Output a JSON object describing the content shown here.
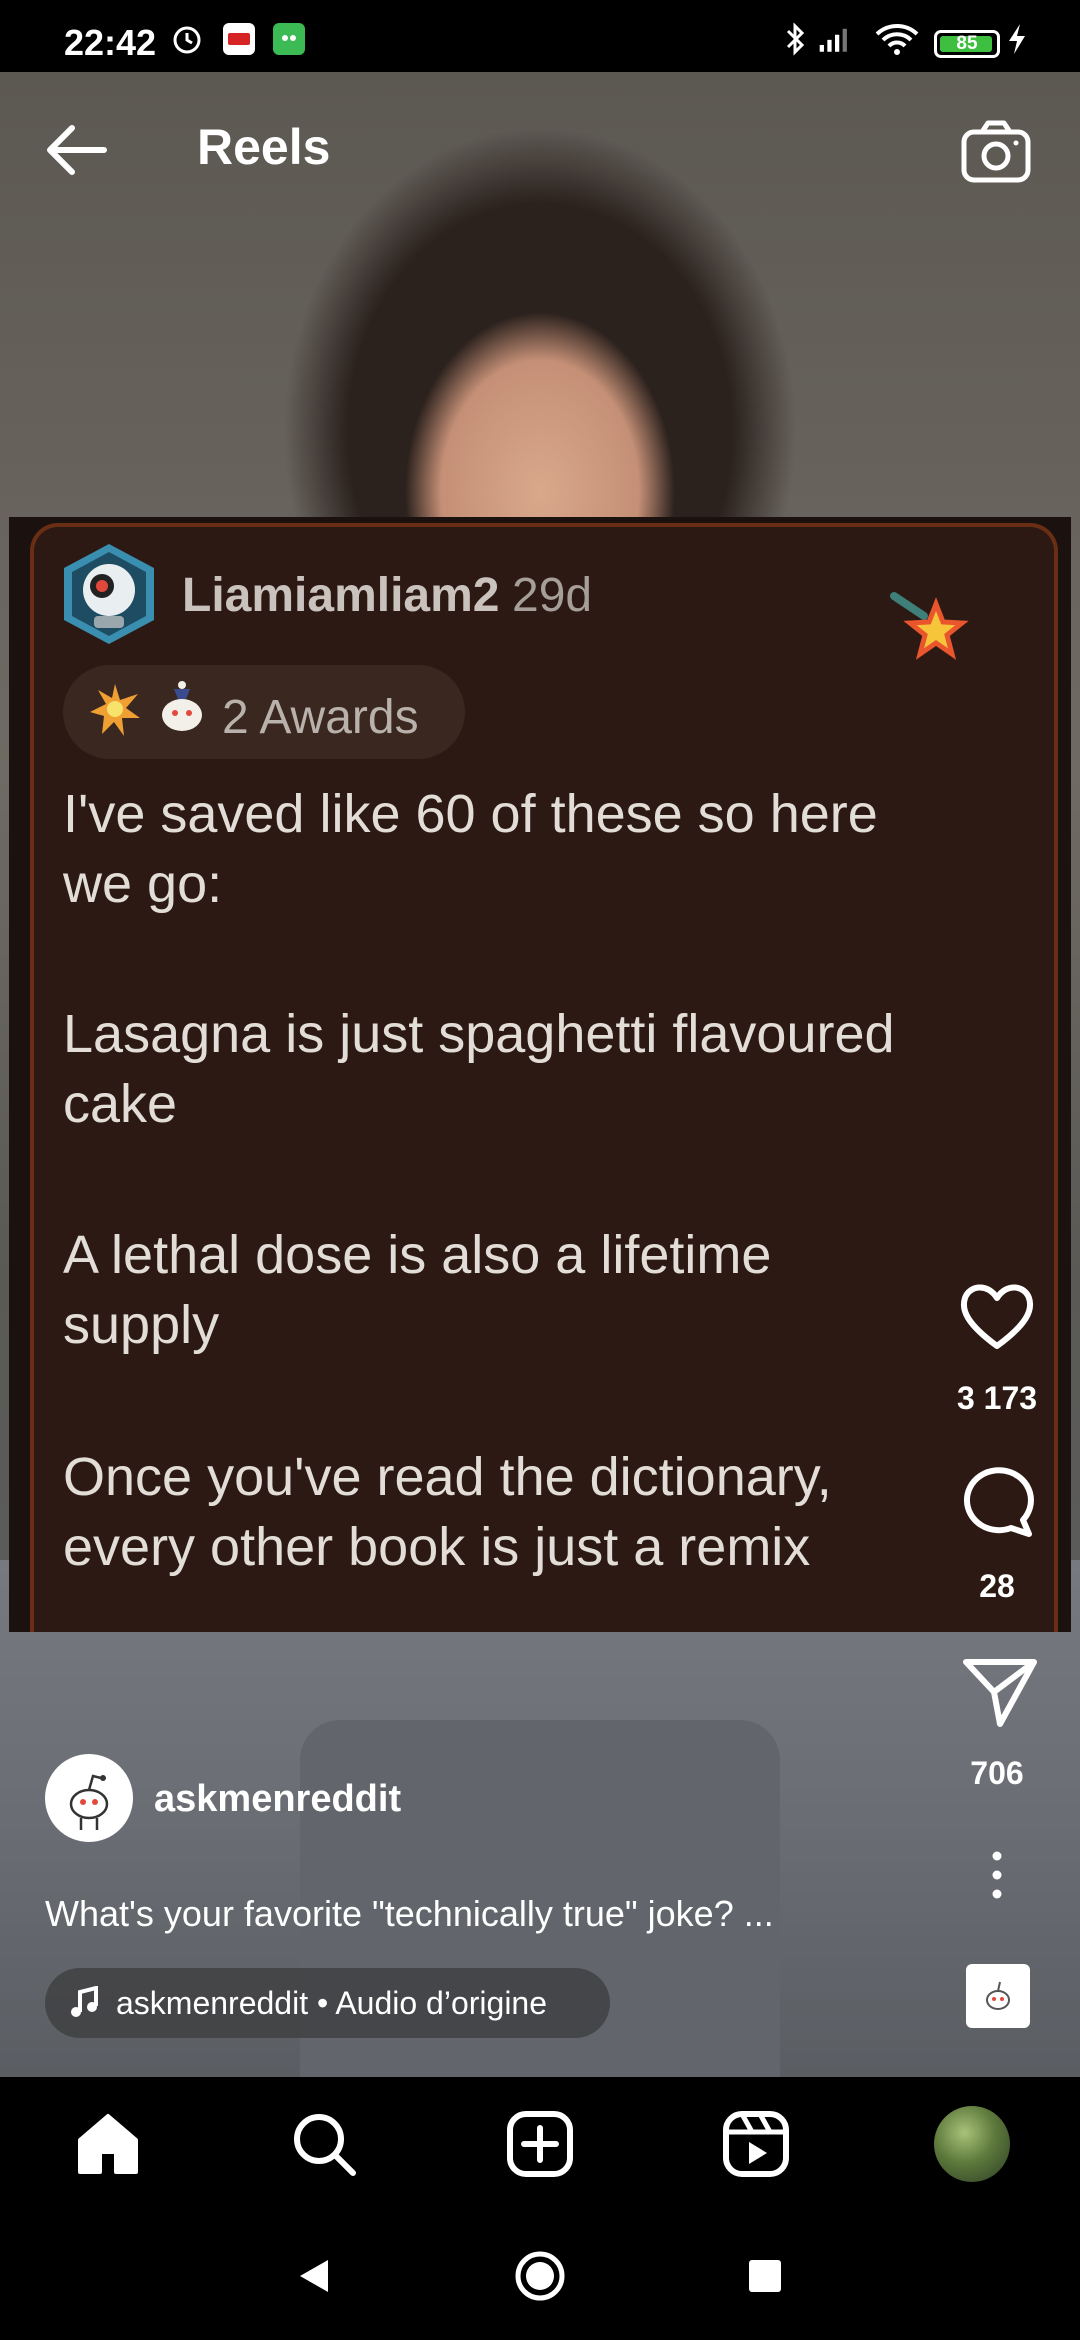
{
  "status_bar": {
    "time": "22:42",
    "battery": "85",
    "icons": [
      "alarm-icon",
      "app-notification-icon",
      "app-notification-icon-2",
      "bluetooth-icon",
      "signal-icon",
      "wifi-icon",
      "battery-icon",
      "charging-icon"
    ]
  },
  "header": {
    "title": "Reels",
    "back_icon": "back-arrow-icon",
    "camera_icon": "camera-icon"
  },
  "post": {
    "username": "Liamiamliam2",
    "age": "29d",
    "awards": "2 Awards",
    "lines": [
      "I've saved like 60 of these so here",
      "we go:",
      "Lasagna is just spaghetti flavoured",
      "cake",
      "A lethal dose is also a lifetime",
      "supply",
      "Once you've read the dictionary,",
      "every other book is just a remix"
    ]
  },
  "actions": {
    "likes": "3 173",
    "comments": "28",
    "shares": "706"
  },
  "author": {
    "name": "askmenreddit",
    "caption": "What's your favorite \"technically true\" joke? ...",
    "audio": "askmenreddit • Audio d’origine"
  },
  "bottom_nav": [
    "home-icon",
    "search-icon",
    "create-icon",
    "reels-icon",
    "profile-avatar"
  ],
  "system_nav": [
    "back-triangle-icon",
    "home-circle-icon",
    "recents-square-icon"
  ],
  "colors": {
    "accent_card_border": "#6a2e15",
    "card_bg": "#2c1913",
    "battery_green": "#3fbf3f"
  }
}
